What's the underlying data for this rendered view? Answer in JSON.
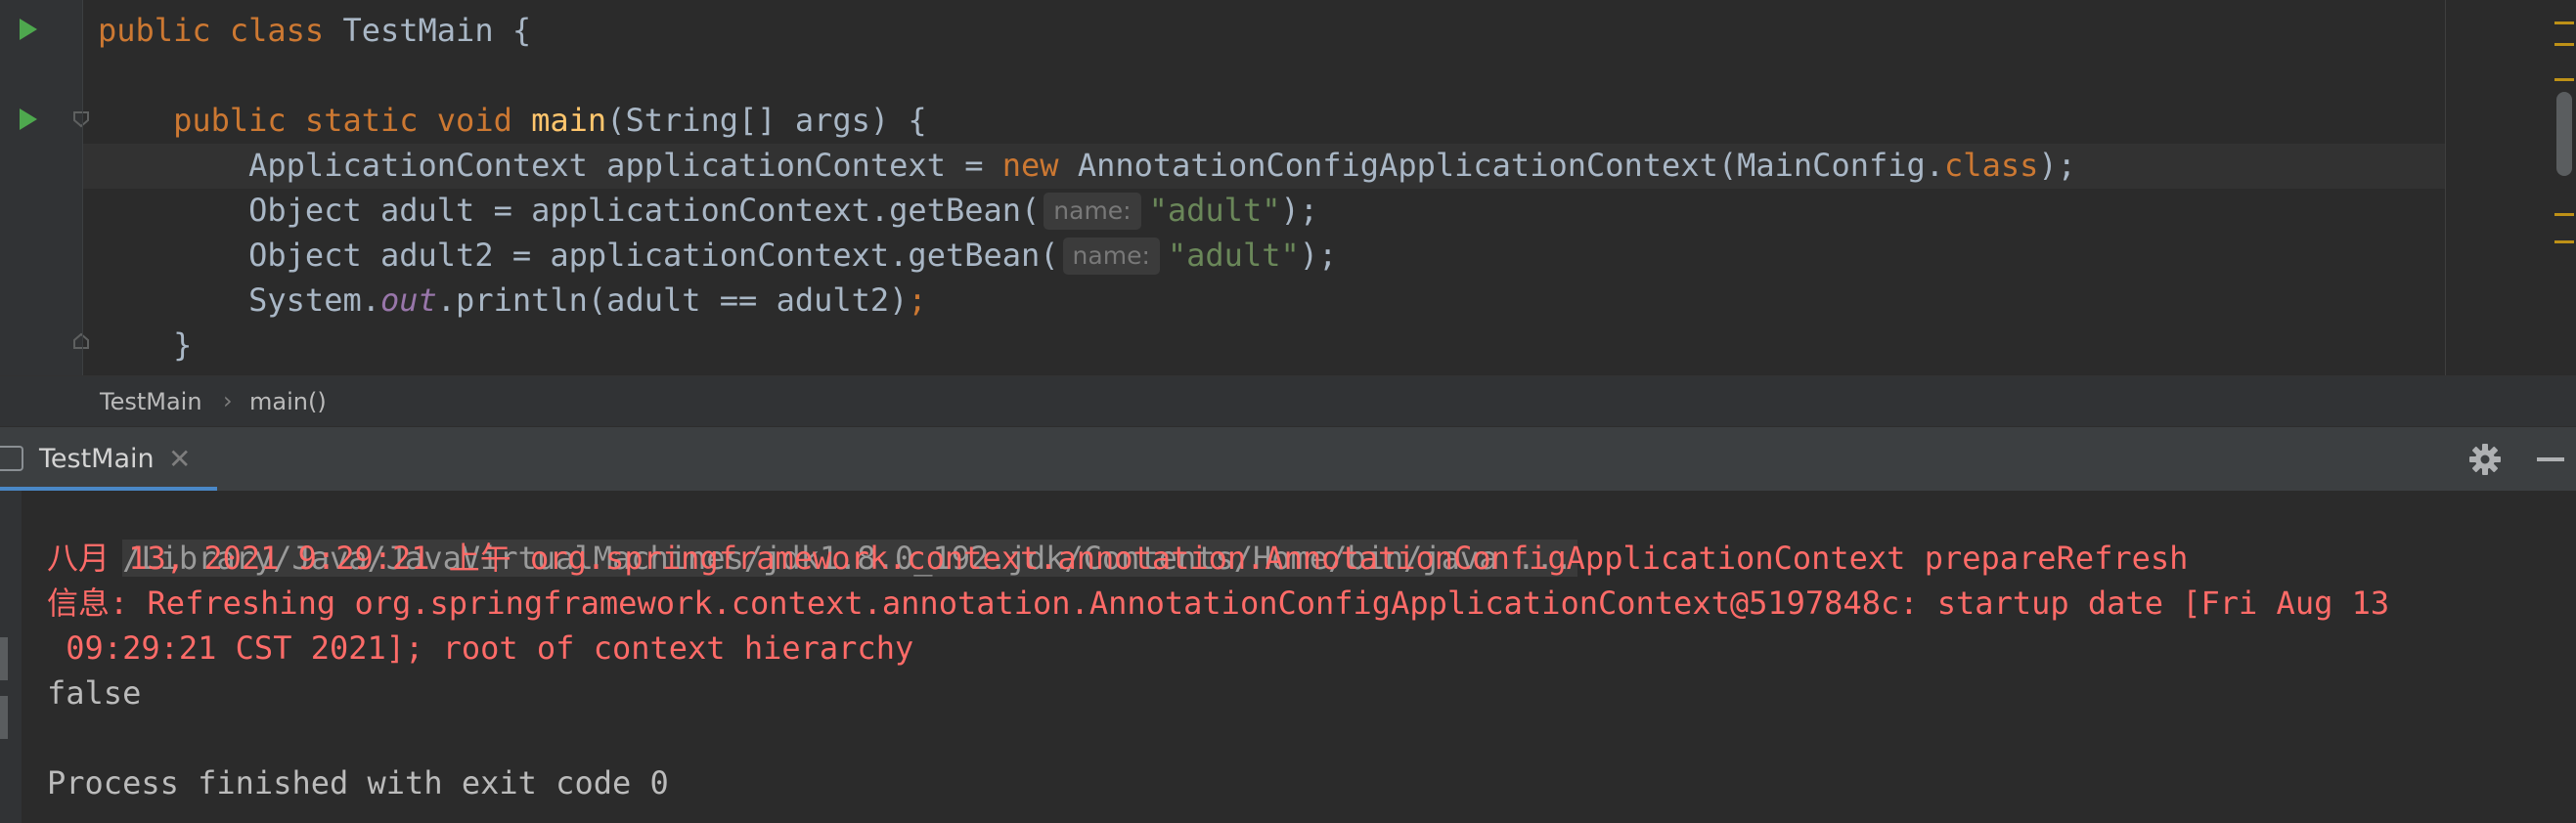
{
  "editor": {
    "lines": [
      {
        "id": "class-decl",
        "parts": [
          {
            "t": "public class ",
            "c": "kw"
          },
          {
            "t": "TestMain {",
            "c": ""
          }
        ]
      },
      {
        "id": "blank",
        "parts": []
      },
      {
        "id": "main-decl",
        "parts": [
          {
            "t": "    public static void ",
            "c": "kw"
          },
          {
            "t": "main",
            "c": "fn"
          },
          {
            "t": "(String[] args) {",
            "c": ""
          }
        ]
      },
      {
        "id": "context-line",
        "parts": [
          {
            "t": "        ApplicationContext applicationContext = ",
            "c": ""
          },
          {
            "t": "new ",
            "c": "kw"
          },
          {
            "t": "AnnotationConfigApplicationContext(MainConfig.",
            "c": ""
          },
          {
            "t": "class",
            "c": "kw"
          },
          {
            "t": ");",
            "c": ""
          }
        ]
      },
      {
        "id": "adult-line",
        "parts": [
          {
            "t": "        Object adult = applicationContext.getBean(",
            "c": ""
          },
          {
            "hint": "name:"
          },
          {
            "t": "\"adult\"",
            "c": "str"
          },
          {
            "t": ");",
            "c": ""
          }
        ]
      },
      {
        "id": "adult2-line",
        "parts": [
          {
            "t": "        Object adult2 = applicationContext.getBean(",
            "c": ""
          },
          {
            "hint": "name:"
          },
          {
            "t": "\"adult\"",
            "c": "str"
          },
          {
            "t": ");",
            "c": ""
          }
        ]
      },
      {
        "id": "println-line",
        "parts": [
          {
            "t": "        System.",
            "c": ""
          },
          {
            "t": "out",
            "c": "field"
          },
          {
            "t": ".println(adult == adult2)",
            "c": ""
          },
          {
            "t": ";",
            "c": "kw"
          }
        ]
      },
      {
        "id": "close-brace",
        "parts": [
          {
            "t": "    }",
            "c": ""
          }
        ]
      }
    ]
  },
  "breadcrumb": {
    "class_name": "TestMain",
    "separator": "›",
    "method_name": "main()"
  },
  "run_window": {
    "tab_label": "TestMain",
    "tab_close": "✕",
    "settings_icon": "gear-icon",
    "minimize_icon": "minimize-icon"
  },
  "console": {
    "command": "/Library/Java/JavaVirtualMachines/jdk1.8.0_192.jdk/Contents/Home/bin/java ...",
    "log_line1": "八月 13, 2021 9:29:21 上午 org.springframework.context.annotation.AnnotationConfigApplicationContext prepareRefresh",
    "log_line2": "信息: Refreshing org.springframework.context.annotation.AnnotationConfigApplicationContext@5197848c: startup date [Fri Aug 13",
    "log_line3": " 09:29:21 CST 2021]; root of context hierarchy",
    "output": "false",
    "exit_message": "Process finished with exit code 0"
  },
  "colors": {
    "keyword": "#cc7832",
    "method": "#ffc66d",
    "string": "#6a8759",
    "field": "#9876aa",
    "error_text": "#ff6b68",
    "accent": "#4a88c7"
  }
}
